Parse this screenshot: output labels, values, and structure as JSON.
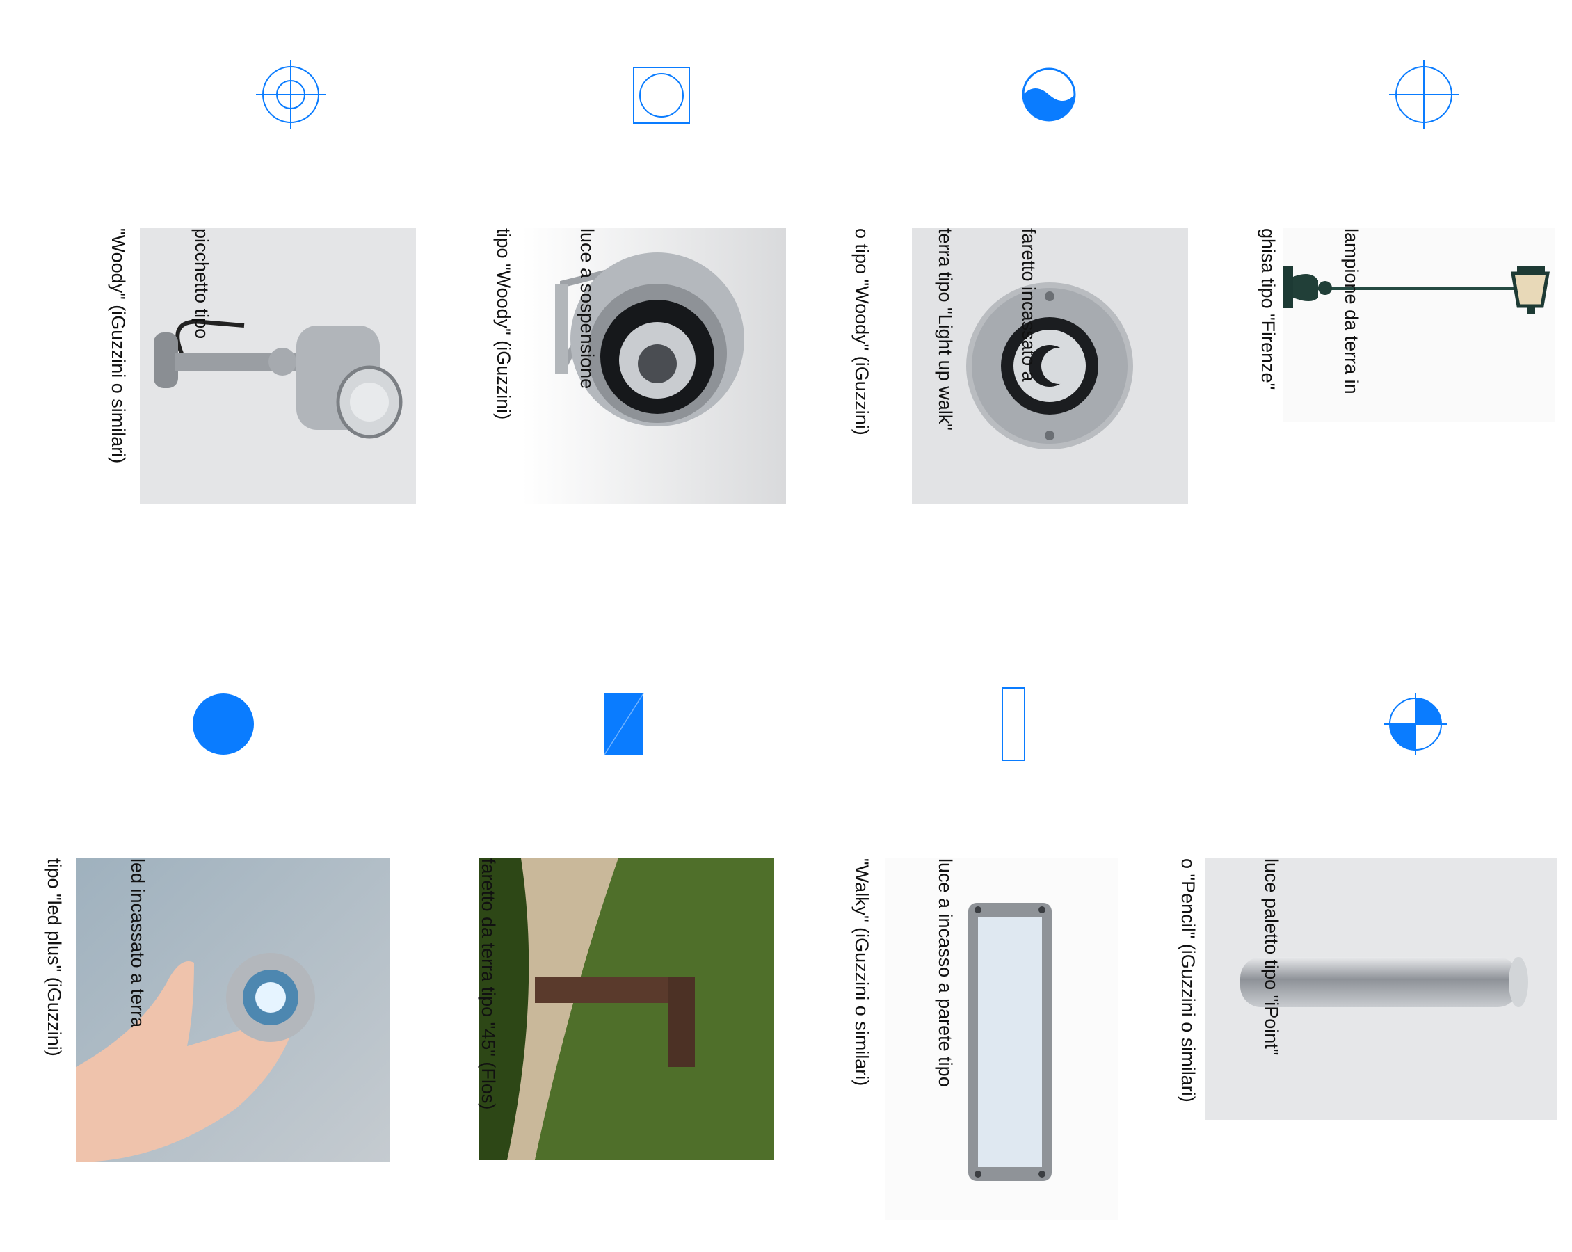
{
  "colors": {
    "symbol_blue": "#0a7cff",
    "photo_grey": "#e4e5e7"
  },
  "legend": [
    {
      "key": "firenze",
      "symbol": "crosshair-circle-icon",
      "lines": [
        "lampione da terra in",
        "ghisa tipo \"Firenze\""
      ]
    },
    {
      "key": "lightup",
      "symbol": "half-filled-wave-circle-icon",
      "lines": [
        "faretto incassato a",
        "terra tipo \"Light up walk\"",
        "o tipo \"Woody\" (iGuzzini)"
      ]
    },
    {
      "key": "sospensione",
      "symbol": "circle-in-square-icon",
      "lines": [
        "luce a sospensione",
        "tipo \"Woody\" (iGuzzini)"
      ]
    },
    {
      "key": "picchetto",
      "symbol": "double-circle-crosshair-icon",
      "lines": [
        "picchetto tipo",
        "\"Woody\" (iGuzzini o similari)"
      ]
    },
    {
      "key": "pencil",
      "symbol": "quartered-circle-icon",
      "lines": [
        "luce paletto tipo \"iPoint\"",
        "o \"Pencil\" (iGuzzini o similari)"
      ]
    },
    {
      "key": "walky",
      "symbol": "outline-rectangle-icon",
      "lines": [
        "luce a incasso a parete tipo",
        "\"Walky\" (iGuzzini o similari)"
      ]
    },
    {
      "key": "flos45",
      "symbol": "diagonal-filled-rectangle-icon",
      "lines": [
        "faretto da terra tipo \"45\" (Flos)"
      ]
    },
    {
      "key": "ledplus",
      "symbol": "filled-circle-icon",
      "lines": [
        "led incassato a terra",
        "tipo \"led plus\" (iGuzzini)"
      ]
    }
  ]
}
